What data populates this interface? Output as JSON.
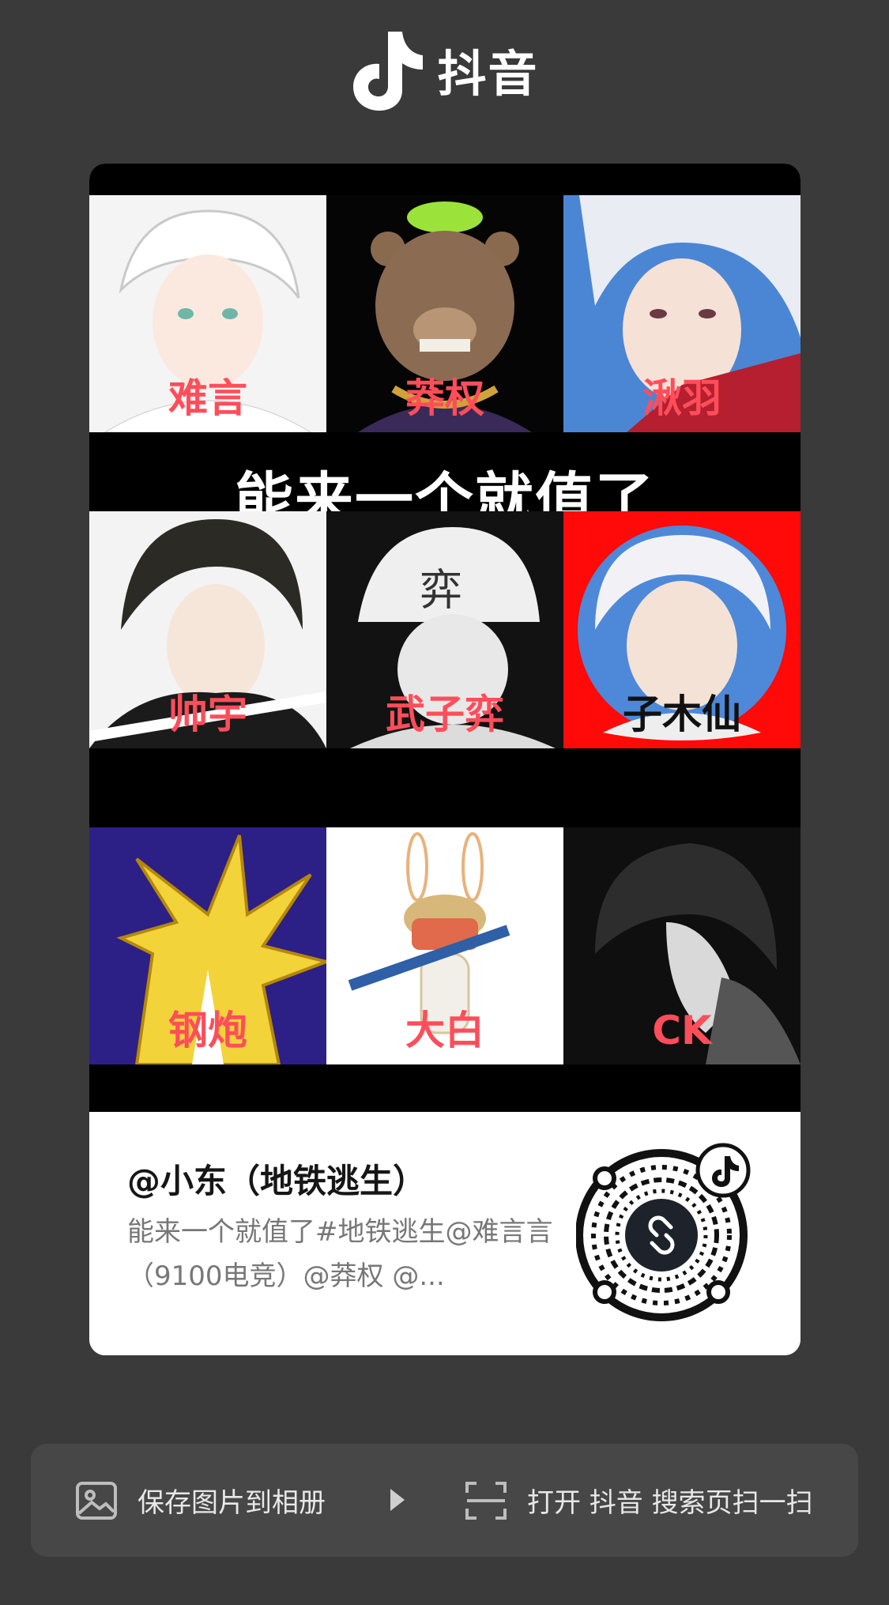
{
  "app": {
    "name": "抖音"
  },
  "cover": {
    "title": "能来一个就值了",
    "tiles": [
      {
        "name": "难言"
      },
      {
        "name": "莽权"
      },
      {
        "name": "湫羽"
      },
      {
        "name": "帅宇"
      },
      {
        "name": "武子弈"
      },
      {
        "name": "子木仙"
      },
      {
        "name": "钢炮"
      },
      {
        "name": "大白"
      },
      {
        "name": "CK"
      }
    ]
  },
  "video": {
    "author": "@小东（地铁逃生）",
    "description": "能来一个就值了#地铁逃生@难言言（9100电竞）@莽权 @..."
  },
  "actions": {
    "save_label": "保存图片到相册",
    "scan_label": "打开 抖音 搜索页扫一扫"
  },
  "colors": {
    "background": "#3a3a3a",
    "label_red": "#ff4d5a",
    "action_bar": "#474747"
  },
  "icons": {
    "logo": "douyin-note-icon",
    "save": "image-icon",
    "arrow": "play-arrow-icon",
    "scan": "scan-icon",
    "qr_center": "link-icon"
  }
}
